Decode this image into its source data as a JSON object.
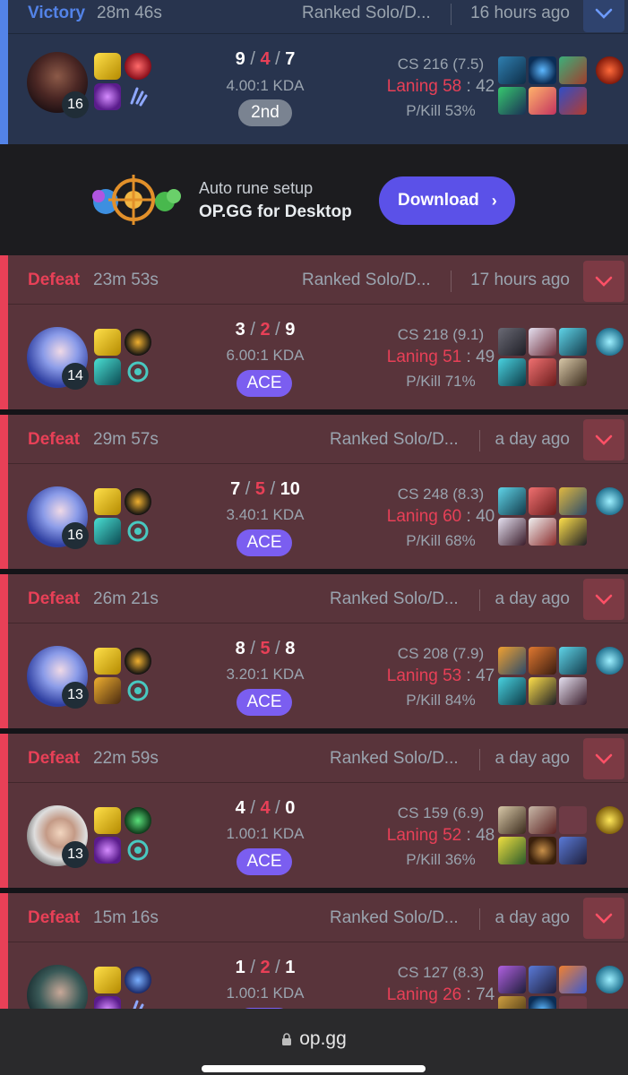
{
  "ad": {
    "line1": "Auto rune setup",
    "line2": "OP.GG for Desktop",
    "button": "Download",
    "button_chevron": "›"
  },
  "browser": {
    "url": "op.gg"
  },
  "colors": {
    "victory": "#5383e8",
    "defeat": "#e84057",
    "victory_bg": "#28344e",
    "defeat_bg": "#59343b",
    "ace_badge": "#7b5ef0",
    "download_button": "#5b51e8"
  },
  "matches": [
    {
      "result": "Victory",
      "duration": "28m 46s",
      "queue": "Ranked Solo/D...",
      "time_ago": "16 hours ago",
      "level": "16",
      "k": "9",
      "d": "4",
      "a": "7",
      "sep": "/",
      "kda_ratio": "4.00:1 KDA",
      "badge": "2nd",
      "cs": "CS 216 (7.5)",
      "laning_label": "Laning",
      "laning_value": "58",
      "laning_colon": ":",
      "laning_opp": "42",
      "pkill": "P/Kill 53%"
    },
    {
      "result": "Defeat",
      "duration": "23m 53s",
      "queue": "Ranked Solo/D...",
      "time_ago": "17 hours ago",
      "level": "14",
      "k": "3",
      "d": "2",
      "a": "9",
      "sep": "/",
      "kda_ratio": "6.00:1 KDA",
      "badge": "ACE",
      "cs": "CS 218 (9.1)",
      "laning_label": "Laning",
      "laning_value": "51",
      "laning_colon": ":",
      "laning_opp": "49",
      "pkill": "P/Kill 71%"
    },
    {
      "result": "Defeat",
      "duration": "29m 57s",
      "queue": "Ranked Solo/D...",
      "time_ago": "a day ago",
      "level": "16",
      "k": "7",
      "d": "5",
      "a": "10",
      "sep": "/",
      "kda_ratio": "3.40:1 KDA",
      "badge": "ACE",
      "cs": "CS 248 (8.3)",
      "laning_label": "Laning",
      "laning_value": "60",
      "laning_colon": ":",
      "laning_opp": "40",
      "pkill": "P/Kill 68%"
    },
    {
      "result": "Defeat",
      "duration": "26m 21s",
      "queue": "Ranked Solo/D...",
      "time_ago": "a day ago",
      "level": "13",
      "k": "8",
      "d": "5",
      "a": "8",
      "sep": "/",
      "kda_ratio": "3.20:1 KDA",
      "badge": "ACE",
      "cs": "CS 208 (7.9)",
      "laning_label": "Laning",
      "laning_value": "53",
      "laning_colon": ":",
      "laning_opp": "47",
      "pkill": "P/Kill 84%"
    },
    {
      "result": "Defeat",
      "duration": "22m 59s",
      "queue": "Ranked Solo/D...",
      "time_ago": "a day ago",
      "level": "13",
      "k": "4",
      "d": "4",
      "a": "0",
      "sep": "/",
      "kda_ratio": "1.00:1 KDA",
      "badge": "ACE",
      "cs": "CS 159 (6.9)",
      "laning_label": "Laning",
      "laning_value": "52",
      "laning_colon": ":",
      "laning_opp": "48",
      "pkill": "P/Kill 36%"
    },
    {
      "result": "Defeat",
      "duration": "15m 16s",
      "queue": "Ranked Solo/D...",
      "time_ago": "a day ago",
      "level": "",
      "k": "1",
      "d": "2",
      "a": "1",
      "sep": "/",
      "kda_ratio": "1.00:1 KDA",
      "badge": "",
      "cs": "CS 127 (8.3)",
      "laning_label": "Laning",
      "laning_value": "26",
      "laning_colon": ":",
      "laning_opp": "74",
      "pkill": ""
    }
  ]
}
